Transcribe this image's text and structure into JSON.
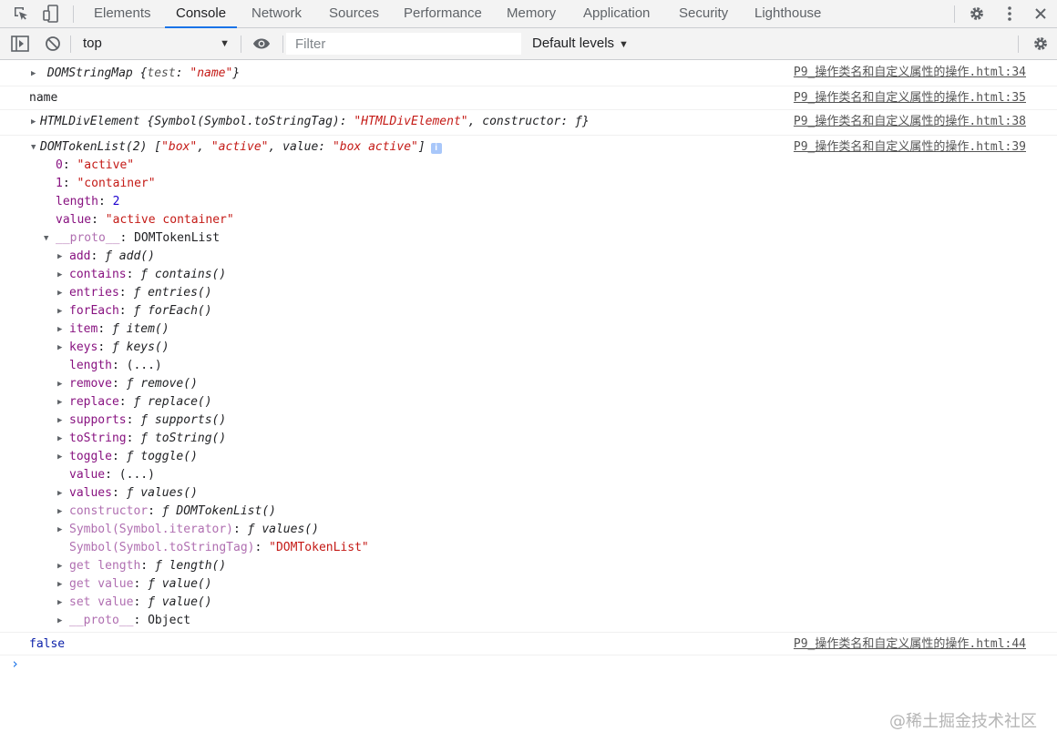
{
  "tabs": [
    "Elements",
    "Console",
    "Network",
    "Sources",
    "Performance",
    "Memory",
    "Application",
    "Security",
    "Lighthouse"
  ],
  "active_tab": "Console",
  "toolbar": {
    "context": "top",
    "filter_placeholder": "Filter",
    "levels": "Default levels"
  },
  "messages": {
    "m1": {
      "name": "DOMStringMap",
      "brace_open": "{",
      "key": "test",
      "colon": ": ",
      "value": "\"name\"",
      "brace_close": "}",
      "source": "P9_操作类名和自定义属性的操作.html:34"
    },
    "m2": {
      "text": "name",
      "source": "P9_操作类名和自定义属性的操作.html:35"
    },
    "m3": {
      "name": "HTMLDivElement",
      "pre": "{Symbol(Symbol.toStringTag): ",
      "value": "\"HTMLDivElement\"",
      "post": ", constructor: ƒ}",
      "source": "P9_操作类名和自定义属性的操作.html:38"
    },
    "m4": {
      "header": {
        "name": "DOMTokenList(2)",
        "open": "[",
        "v1": "\"box\"",
        "comma": ", ",
        "v2": "\"active\"",
        "value_key": ", value: ",
        "v3": "\"box active\"",
        "close": "]",
        "info_icon": "i"
      },
      "source": "P9_操作类名和自定义属性的操作.html:39",
      "props": [
        {
          "key": "0",
          "value": "\"active\""
        },
        {
          "key": "1",
          "value": "\"container\""
        },
        {
          "key": "length",
          "value": "2"
        },
        {
          "key": "value",
          "value": "\"active container\""
        }
      ],
      "proto_key": "__proto__",
      "proto_value": "DOMTokenList",
      "proto_items": [
        {
          "key": "add",
          "value": "ƒ add()"
        },
        {
          "key": "contains",
          "value": "ƒ contains()"
        },
        {
          "key": "entries",
          "value": "ƒ entries()"
        },
        {
          "key": "forEach",
          "value": "ƒ forEach()"
        },
        {
          "key": "item",
          "value": "ƒ item()"
        },
        {
          "key": "keys",
          "value": "ƒ keys()"
        },
        {
          "key": "length",
          "value": "(...)"
        },
        {
          "key": "remove",
          "value": "ƒ remove()"
        },
        {
          "key": "replace",
          "value": "ƒ replace()"
        },
        {
          "key": "supports",
          "value": "ƒ supports()"
        },
        {
          "key": "toString",
          "value": "ƒ toString()"
        },
        {
          "key": "toggle",
          "value": "ƒ toggle()"
        },
        {
          "key": "value",
          "value": "(...)"
        },
        {
          "key": "values",
          "value": "ƒ values()"
        },
        {
          "key": "constructor",
          "value": "ƒ DOMTokenList()"
        },
        {
          "key": "Symbol(Symbol.iterator)",
          "value": "ƒ values()"
        },
        {
          "key": "Symbol(Symbol.toStringTag)",
          "value": "\"DOMTokenList\""
        },
        {
          "key": "get length",
          "value": "ƒ length()"
        },
        {
          "key": "get value",
          "value": "ƒ value()"
        },
        {
          "key": "set value",
          "value": "ƒ value()"
        },
        {
          "key": "__proto__",
          "value": "Object"
        }
      ]
    },
    "m5": {
      "text": "false",
      "source": "P9_操作类名和自定义属性的操作.html:44"
    }
  },
  "prompt_symbol": "›",
  "watermark": "@稀土掘金技术社区",
  "colors": {
    "accent": "#1a73e8",
    "string": "#c41a16",
    "key": "#881280"
  }
}
